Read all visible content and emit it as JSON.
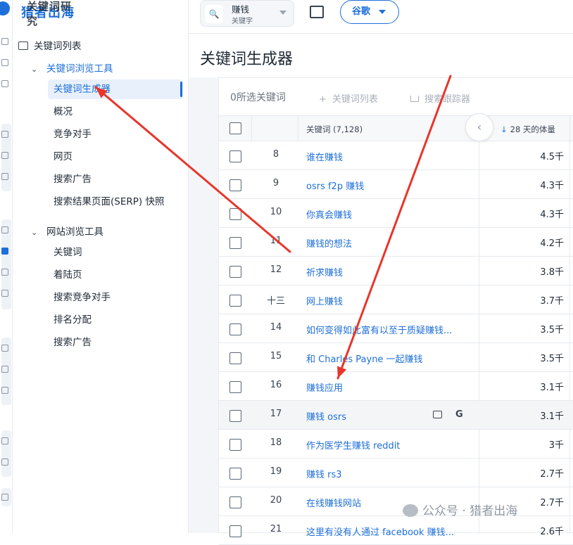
{
  "app": {
    "brand": "猎者出海",
    "brand_overlay": "关键词研究"
  },
  "sidebar": {
    "top_item": "关键词列表",
    "sections": [
      {
        "label": "关键词浏览工具",
        "items": [
          "关键词生成器",
          "概况",
          "竞争对手",
          "网页",
          "搜索广告",
          "搜索结果页面(SERP) 快照"
        ]
      },
      {
        "label": "网站浏览工具",
        "items": [
          "关键词",
          "着陆页",
          "搜索竞争对手",
          "排名分配",
          "搜索广告"
        ]
      }
    ],
    "active_item": "关键词生成器"
  },
  "topbar": {
    "search_value": "赚钱",
    "search_type": "关键字",
    "engine": "谷歌"
  },
  "page_title": "关键词生成器",
  "toolbar": {
    "selected": "0所选关键词",
    "add_to_list": "关键词列表",
    "rank_tracker": "搜索跟踪器"
  },
  "table": {
    "col_keyword": "关键词 (7,128)",
    "col_volume": "28 天的体量",
    "rows": [
      {
        "num": "8",
        "keyword": "谁在赚钱",
        "volume": "4.5千"
      },
      {
        "num": "9",
        "keyword": "osrs f2p 赚钱",
        "volume": "4.3千"
      },
      {
        "num": "10",
        "keyword": "你真会赚钱",
        "volume": "4.3千"
      },
      {
        "num": "11",
        "keyword": "赚钱的想法",
        "volume": "4.2千"
      },
      {
        "num": "12",
        "keyword": "祈求赚钱",
        "volume": "3.8千"
      },
      {
        "num": "十三",
        "keyword": "网上赚钱",
        "volume": "3.7千"
      },
      {
        "num": "14",
        "keyword": "如何变得如此富有以至于质疑赚钱...",
        "volume": "3.5千"
      },
      {
        "num": "15",
        "keyword": "和 Charles Payne 一起赚钱",
        "volume": "3.5千"
      },
      {
        "num": "16",
        "keyword": "赚钱应用",
        "volume": "3.1千"
      },
      {
        "num": "17",
        "keyword": "赚钱 osrs",
        "volume": "3.1千"
      },
      {
        "num": "18",
        "keyword": "作为医学生赚钱 reddit",
        "volume": "3千"
      },
      {
        "num": "19",
        "keyword": "赚钱 rs3",
        "volume": "2.7千"
      },
      {
        "num": "20",
        "keyword": "在线赚钱网站",
        "volume": "2.7千"
      },
      {
        "num": "21",
        "keyword": "这里有没有人通过 facebook 赚钱...",
        "volume": "2.6千"
      }
    ],
    "hovered_row": 9,
    "row_action_g": "G"
  },
  "watermark": "公众号 · 猎者出海",
  "colors": {
    "accent": "#1e6fd9",
    "annotation_arrow": "#e8352b"
  }
}
